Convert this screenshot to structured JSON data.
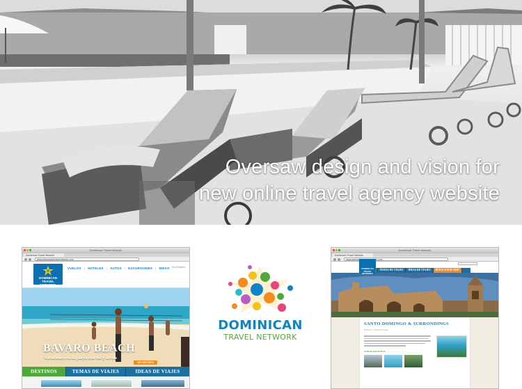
{
  "hero": {
    "caption_line1": "Oversaw design and vision for",
    "caption_line2": "new online travel agency website"
  },
  "logo": {
    "word1": "DOMINICAN",
    "word2": "TRAVEL NETWORK",
    "colors": {
      "primary": "#0f84c4",
      "secondary": "#51a83a",
      "accent": "#f28c1f"
    }
  },
  "browser1": {
    "window_title": "Dominican Travel Network",
    "tab_label": "Dominican Travel Network",
    "url": "www.dominicantravelnetwork.com",
    "site_logo_text": "DOMINICAN TRAVEL NETWORK",
    "nav": [
      "VUELOS",
      "HOTELES",
      "AUTOS",
      "EXCURSIONES",
      "IDEAS"
    ],
    "nav_right": "Usa Dólares",
    "hero_title": "BAVARO BEACH",
    "hero_subtitle": "Vacaciones en la playa con sol y arena",
    "hero_button": "VER DESTINOS",
    "tabs": [
      "DESTINOS",
      "TEMAS DE VIAJES",
      "IDEAS DE VIAJES"
    ]
  },
  "browser2": {
    "window_title": "Dominican Travel Network",
    "tab_label": "Dominican Travel Network",
    "url": "www.dominicantravelnetwork.com",
    "site_logo_text": "DOMINICAN TRAVEL NETWORK",
    "nav": [
      "DESTINOS",
      "TEMAS DE VIAJES",
      "IDEAS DE VIAJES",
      "BUILD YOUR TRIP"
    ],
    "page_title": "SANTO DOMINGO & SURRONDINGS",
    "breadcrumb": "Destinos  ›  Santo Domingo",
    "section_label": "OTROS DESTINOS"
  }
}
